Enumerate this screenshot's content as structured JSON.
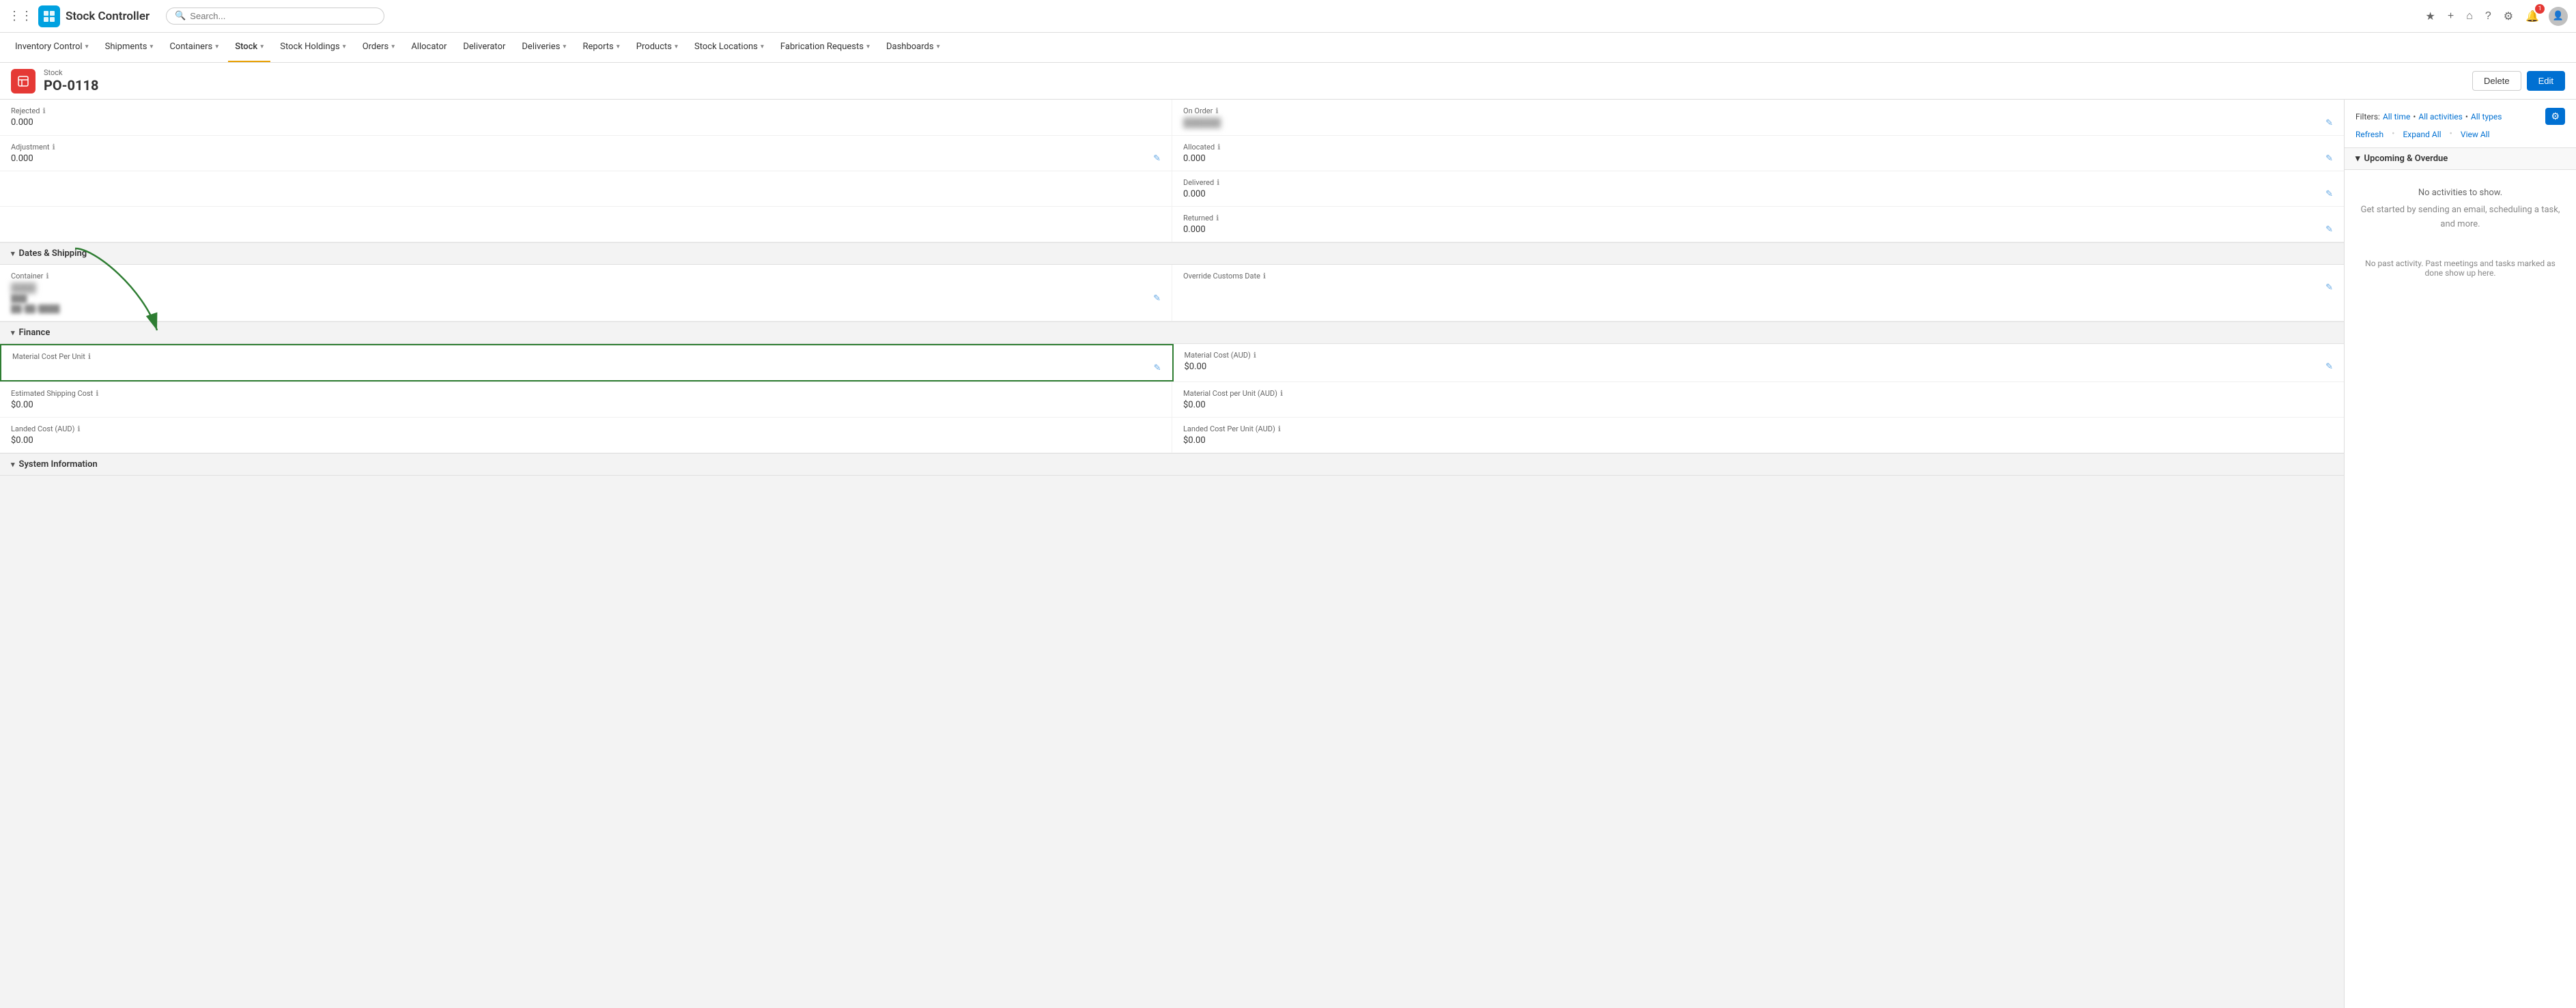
{
  "app": {
    "icon_char": "⬡",
    "title": "Stock Controller"
  },
  "search": {
    "placeholder": "Search..."
  },
  "nav": {
    "items": [
      {
        "label": "Inventory Control",
        "has_dropdown": true,
        "active": false
      },
      {
        "label": "Shipments",
        "has_dropdown": true,
        "active": false
      },
      {
        "label": "Containers",
        "has_dropdown": true,
        "active": false
      },
      {
        "label": "Stock",
        "has_dropdown": true,
        "active": true
      },
      {
        "label": "Stock Holdings",
        "has_dropdown": true,
        "active": false
      },
      {
        "label": "Orders",
        "has_dropdown": true,
        "active": false
      },
      {
        "label": "Allocator",
        "has_dropdown": false,
        "active": false
      },
      {
        "label": "Deliverator",
        "has_dropdown": false,
        "active": false
      },
      {
        "label": "Deliveries",
        "has_dropdown": true,
        "active": false
      },
      {
        "label": "Reports",
        "has_dropdown": true,
        "active": false
      },
      {
        "label": "Products",
        "has_dropdown": true,
        "active": false
      },
      {
        "label": "Stock Locations",
        "has_dropdown": true,
        "active": false
      },
      {
        "label": "Fabrication Requests",
        "has_dropdown": true,
        "active": false
      },
      {
        "label": "Dashboards",
        "has_dropdown": true,
        "active": false
      }
    ]
  },
  "page_header": {
    "type": "Stock",
    "title": "PO-0118",
    "delete_label": "Delete",
    "edit_label": "Edit"
  },
  "form": {
    "sections": {
      "dates_shipping": {
        "title": "Dates & Shipping",
        "container_label": "Container",
        "container_value": "",
        "override_customs_label": "Override Customs Date"
      },
      "finance": {
        "title": "Finance",
        "material_cost_per_unit_label": "Material Cost Per Unit",
        "material_cost_aud_label": "Material Cost (AUD)",
        "material_cost_aud_value": "$0.00",
        "estimated_shipping_label": "Estimated Shipping Cost",
        "estimated_shipping_value": "$0.00",
        "material_cost_per_unit_aud_label": "Material Cost per Unit (AUD)",
        "material_cost_per_unit_aud_value": "$0.00",
        "landed_cost_label": "Landed Cost (AUD)",
        "landed_cost_value": "$0.00",
        "landed_cost_per_unit_label": "Landed Cost Per Unit (AUD)",
        "landed_cost_per_unit_value": "$0.00"
      },
      "system_info": {
        "title": "System Information"
      }
    },
    "fields": {
      "rejected_label": "Rejected",
      "rejected_value": "0.000",
      "on_order_label": "On Order",
      "adjustment_label": "Adjustment",
      "adjustment_value": "0.000",
      "allocated_label": "Allocated",
      "allocated_value": "0.000",
      "delivered_label": "Delivered",
      "delivered_value": "0.000",
      "returned_label": "Returned",
      "returned_value": "0.000"
    }
  },
  "activity": {
    "filters_label": "Filters:",
    "filter_time": "All time",
    "filter_activities": "All activities",
    "filter_types": "All types",
    "refresh_label": "Refresh",
    "expand_all_label": "Expand All",
    "view_all_label": "View All",
    "upcoming_section": "Upcoming & Overdue",
    "no_activities": "No activities to show.",
    "get_started": "Get started by sending an email, scheduling a task, and more.",
    "no_past": "No past activity. Past meetings and tasks marked as done show up here."
  }
}
